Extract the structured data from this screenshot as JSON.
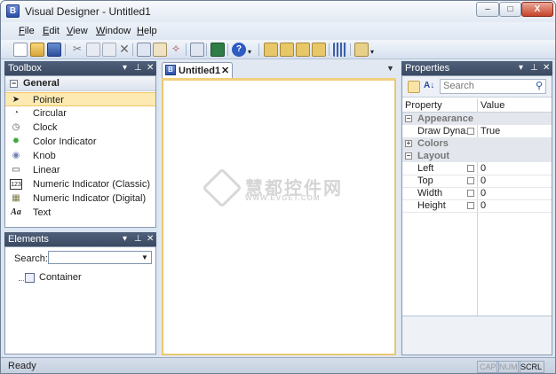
{
  "window": {
    "title": "Visual Designer - Untitled1",
    "app_icon": "B"
  },
  "title_buttons": {
    "minimize": "–",
    "maximize": "□",
    "close": "X"
  },
  "menu": [
    {
      "label": "File",
      "accel": "F",
      "rest": "ile"
    },
    {
      "label": "Edit",
      "accel": "E",
      "rest": "dit"
    },
    {
      "label": "View",
      "accel": "V",
      "rest": "iew"
    },
    {
      "label": "Window",
      "accel": "W",
      "rest": "indow"
    },
    {
      "label": "Help",
      "accel": "H",
      "rest": "elp"
    }
  ],
  "toolbox": {
    "title": "Toolbox",
    "group": "General",
    "items": [
      {
        "label": "Pointer",
        "icon": "pointer-icon",
        "glyph": "➤",
        "selected": true
      },
      {
        "label": "Circular",
        "icon": "circular-gauge-icon",
        "glyph": "◔"
      },
      {
        "label": "Clock",
        "icon": "clock-icon",
        "glyph": "◷"
      },
      {
        "label": "Color Indicator",
        "icon": "color-indicator-icon",
        "glyph": "✹"
      },
      {
        "label": "Knob",
        "icon": "knob-icon",
        "glyph": "◉"
      },
      {
        "label": "Linear",
        "icon": "linear-gauge-icon",
        "glyph": "▭"
      },
      {
        "label": "Numeric Indicator (Classic)",
        "icon": "numeric-classic-icon",
        "glyph": "123"
      },
      {
        "label": "Numeric Indicator (Digital)",
        "icon": "numeric-digital-icon",
        "glyph": "▦"
      },
      {
        "label": "Text",
        "icon": "text-icon",
        "glyph": "Aa"
      }
    ]
  },
  "elements": {
    "title": "Elements",
    "search_label": "Search:",
    "search_value": "",
    "tree": [
      {
        "label": "Container"
      }
    ]
  },
  "document": {
    "tab_label": "Untitled1",
    "tab_close": "✕"
  },
  "watermark": {
    "cn": "慧都控件网",
    "url": "WWW.EVGET.COM"
  },
  "properties": {
    "title": "Properties",
    "search_placeholder": "Search",
    "col_property": "Property",
    "col_value": "Value",
    "rows": [
      {
        "kind": "cat",
        "exp": "−",
        "name": "Appearance"
      },
      {
        "kind": "prop",
        "name": "Draw Dyna...",
        "value": "True"
      },
      {
        "kind": "cat",
        "exp": "+",
        "name": "Colors"
      },
      {
        "kind": "cat",
        "exp": "−",
        "name": "Layout"
      },
      {
        "kind": "prop",
        "name": "Left",
        "value": "0"
      },
      {
        "kind": "prop",
        "name": "Top",
        "value": "0"
      },
      {
        "kind": "prop",
        "name": "Width",
        "value": "0"
      },
      {
        "kind": "prop",
        "name": "Height",
        "value": "0"
      }
    ]
  },
  "status": {
    "text": "Ready",
    "indicators": [
      {
        "label": "CAP",
        "on": false
      },
      {
        "label": "NUM",
        "on": false
      },
      {
        "label": "SCRL",
        "on": true
      }
    ]
  },
  "colors": {
    "panel_header": "#3a4a62",
    "selection": "#fde9b2",
    "canvas_border": "#e8c874"
  }
}
